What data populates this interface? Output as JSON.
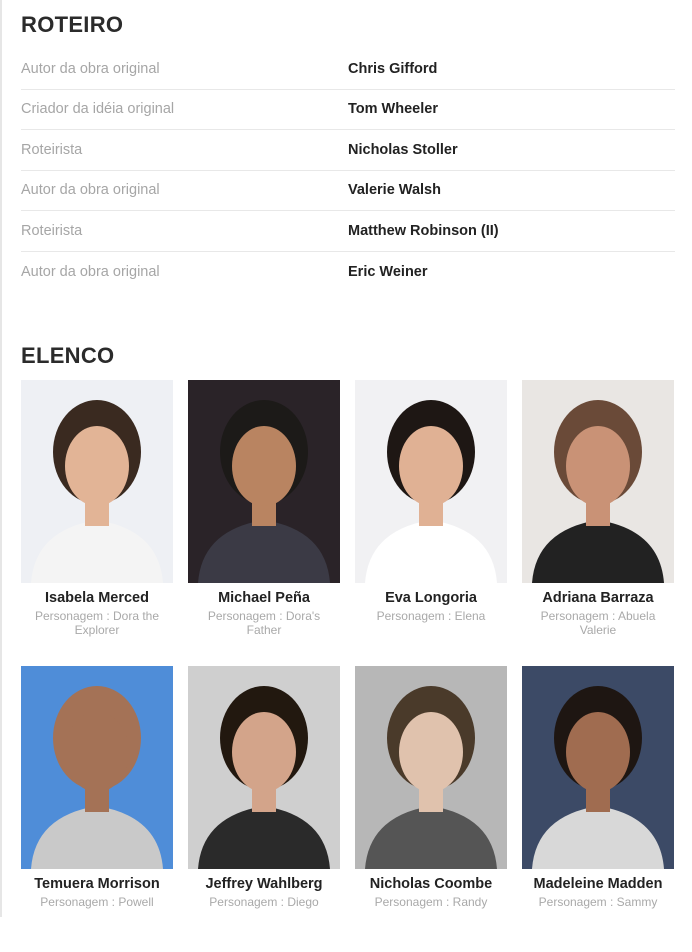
{
  "roteiro": {
    "title": "ROTEIRO",
    "rows": [
      {
        "role": "Autor da obra original",
        "name": "Chris Gifford"
      },
      {
        "role": "Criador da idéia original",
        "name": "Tom Wheeler"
      },
      {
        "role": "Roteirista",
        "name": "Nicholas Stoller"
      },
      {
        "role": "Autor da obra original",
        "name": "Valerie Walsh"
      },
      {
        "role": "Roteirista",
        "name": "Matthew Robinson (II)"
      },
      {
        "role": "Autor da obra original",
        "name": "Eric Weiner"
      }
    ]
  },
  "elenco": {
    "title": "ELENCO",
    "cast": [
      {
        "name": "Isabela Merced",
        "role": "Personagem : Dora the Explorer",
        "bg": "#eef0f4",
        "skin": "#e2b496",
        "hair": "#3a2a20",
        "shirt": "#f4f4f4"
      },
      {
        "name": "Michael Peña",
        "role": "Personagem : Dora's Father",
        "bg": "#2a2328",
        "skin": "#b98461",
        "hair": "#1c1a18",
        "shirt": "#3b3a45"
      },
      {
        "name": "Eva Longoria",
        "role": "Personagem : Elena",
        "bg": "#f1f1f3",
        "skin": "#e0b194",
        "hair": "#1e1714",
        "shirt": "#ffffff"
      },
      {
        "name": "Adriana Barraza",
        "role": "Personagem : Abuela Valerie",
        "bg": "#e9e6e3",
        "skin": "#c99276",
        "hair": "#6a4a38",
        "shirt": "#222222"
      },
      {
        "name": "Temuera Morrison",
        "role": "Personagem : Powell",
        "bg": "#4f8dd8",
        "skin": "#a47256",
        "hair": "#a47256",
        "shirt": "#c9c9c9"
      },
      {
        "name": "Jeffrey Wahlberg",
        "role": "Personagem : Diego",
        "bg": "#cfcfcf",
        "skin": "#d3a48a",
        "hair": "#22180f",
        "shirt": "#2a2a2a"
      },
      {
        "name": "Nicholas Coombe",
        "role": "Personagem : Randy",
        "bg": "#b7b7b7",
        "skin": "#e0c2ad",
        "hair": "#4a3a2a",
        "shirt": "#555555"
      },
      {
        "name": "Madeleine Madden",
        "role": "Personagem : Sammy",
        "bg": "#3c4a66",
        "skin": "#a06c50",
        "hair": "#1e1612",
        "shirt": "#d8d8d8"
      }
    ]
  }
}
